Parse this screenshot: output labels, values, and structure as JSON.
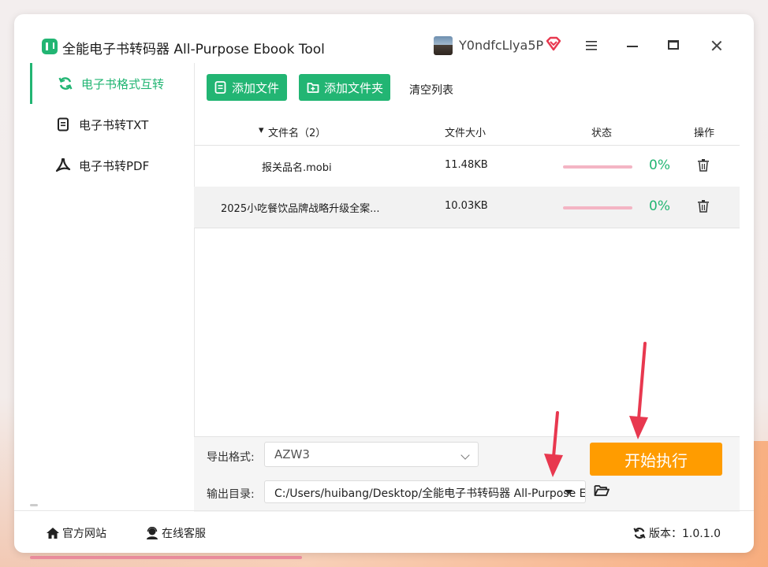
{
  "app": {
    "title": "全能电子书转码器 All-Purpose Ebook Tool",
    "username": "Y0ndfcLlya5P"
  },
  "sidebar": {
    "items": [
      {
        "label": "电子书格式互转",
        "icon": "refresh-icon",
        "active": true
      },
      {
        "label": "电子书转TXT",
        "icon": "document-icon",
        "active": false
      },
      {
        "label": "电子书转PDF",
        "icon": "pdf-icon",
        "active": false
      }
    ]
  },
  "toolbar": {
    "add_file": "添加文件",
    "add_folder": "添加文件夹",
    "clear_list": "清空列表"
  },
  "table": {
    "headers": {
      "name": "文件名（2）",
      "size": "文件大小",
      "status": "状态",
      "action": "操作"
    },
    "rows": [
      {
        "name": "报关品名.mobi",
        "size": "11.48KB",
        "progress": "0%"
      },
      {
        "name": "2025小吃餐饮品牌战略升级全案...",
        "size": "10.03KB",
        "progress": "0%"
      }
    ]
  },
  "output": {
    "format_label": "导出格式:",
    "format_value": "AZW3",
    "dir_label": "输出目录:",
    "dir_value": "C:/Users/huibang/Desktop/全能电子书转码器 All-Purpose Ebook Tool",
    "start_button": "开始执行"
  },
  "footer": {
    "website": "官方网站",
    "support": "在线客服",
    "version": "版本：1.0.1.0"
  },
  "colors": {
    "accent": "#22b573",
    "start_button": "#ff9c00",
    "progress_track": "#f4b5c4",
    "annotation_arrow": "#e8384f"
  }
}
